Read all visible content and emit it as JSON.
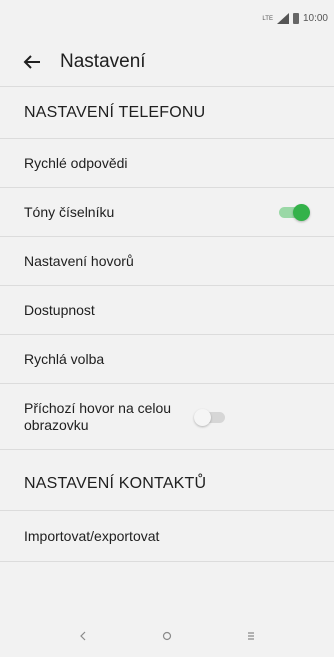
{
  "status_bar": {
    "time": "10:00",
    "network": "LTE",
    "icons": [
      "signal-icon",
      "battery-icon"
    ]
  },
  "header": {
    "title": "Nastavení",
    "back_icon": "arrow-left-icon"
  },
  "sections": [
    {
      "title": "NASTAVENÍ TELEFONU",
      "items": [
        {
          "label": "Rychlé odpovědi"
        },
        {
          "label": "Tóny číselníku",
          "toggle": true
        },
        {
          "label": "Nastavení hovorů"
        },
        {
          "label": "Dostupnost"
        },
        {
          "label": "Rychlá volba"
        },
        {
          "label": "Příchozí hovor na celou obrazovku",
          "toggle": false
        }
      ]
    },
    {
      "title": "NASTAVENÍ KONTAKTŮ",
      "items": [
        {
          "label": "Importovat/exportovat"
        }
      ]
    }
  ],
  "nav_bar": {
    "back": "back-icon",
    "home": "home-icon",
    "recents": "recents-icon"
  },
  "colors": {
    "background": "#f2f2f2",
    "toggle_on": "#34b24a",
    "brand_mark": "#e20074"
  }
}
